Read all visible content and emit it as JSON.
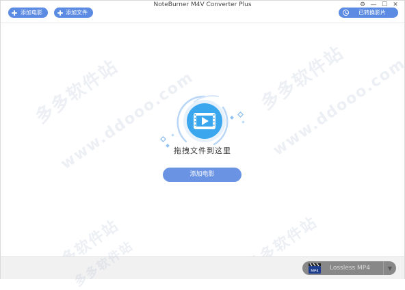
{
  "app": {
    "title": "NoteBurner M4V Converter Plus"
  },
  "toolbar": {
    "add_movie_label": "添加电影",
    "add_file_label": "添加文件",
    "converted_label": "已转换影片"
  },
  "window_controls": {
    "settings_glyph": "⚙",
    "minimize_glyph": "—",
    "maximize_glyph": "☐",
    "close_glyph": "✕"
  },
  "main": {
    "drop_text": "拖拽文件到这里",
    "add_button_label": "添加电影"
  },
  "watermark": {
    "text_cn": "多多软件站",
    "text_url": "www.ddooo.com"
  },
  "bottom": {
    "format_icon_text": "MP4",
    "format_label": "Lossless MP4"
  },
  "colors": {
    "accent": "#5b8be2",
    "icon_primary": "#3aa6ee",
    "format_box": "#888888"
  },
  "icons": {
    "add": "plus-icon",
    "converted": "clock-icon",
    "settings": "gear-icon",
    "minimize": "minimize-icon",
    "maximize": "maximize-icon",
    "close": "close-icon",
    "center": "video-play-icon",
    "format": "clapperboard-icon"
  }
}
